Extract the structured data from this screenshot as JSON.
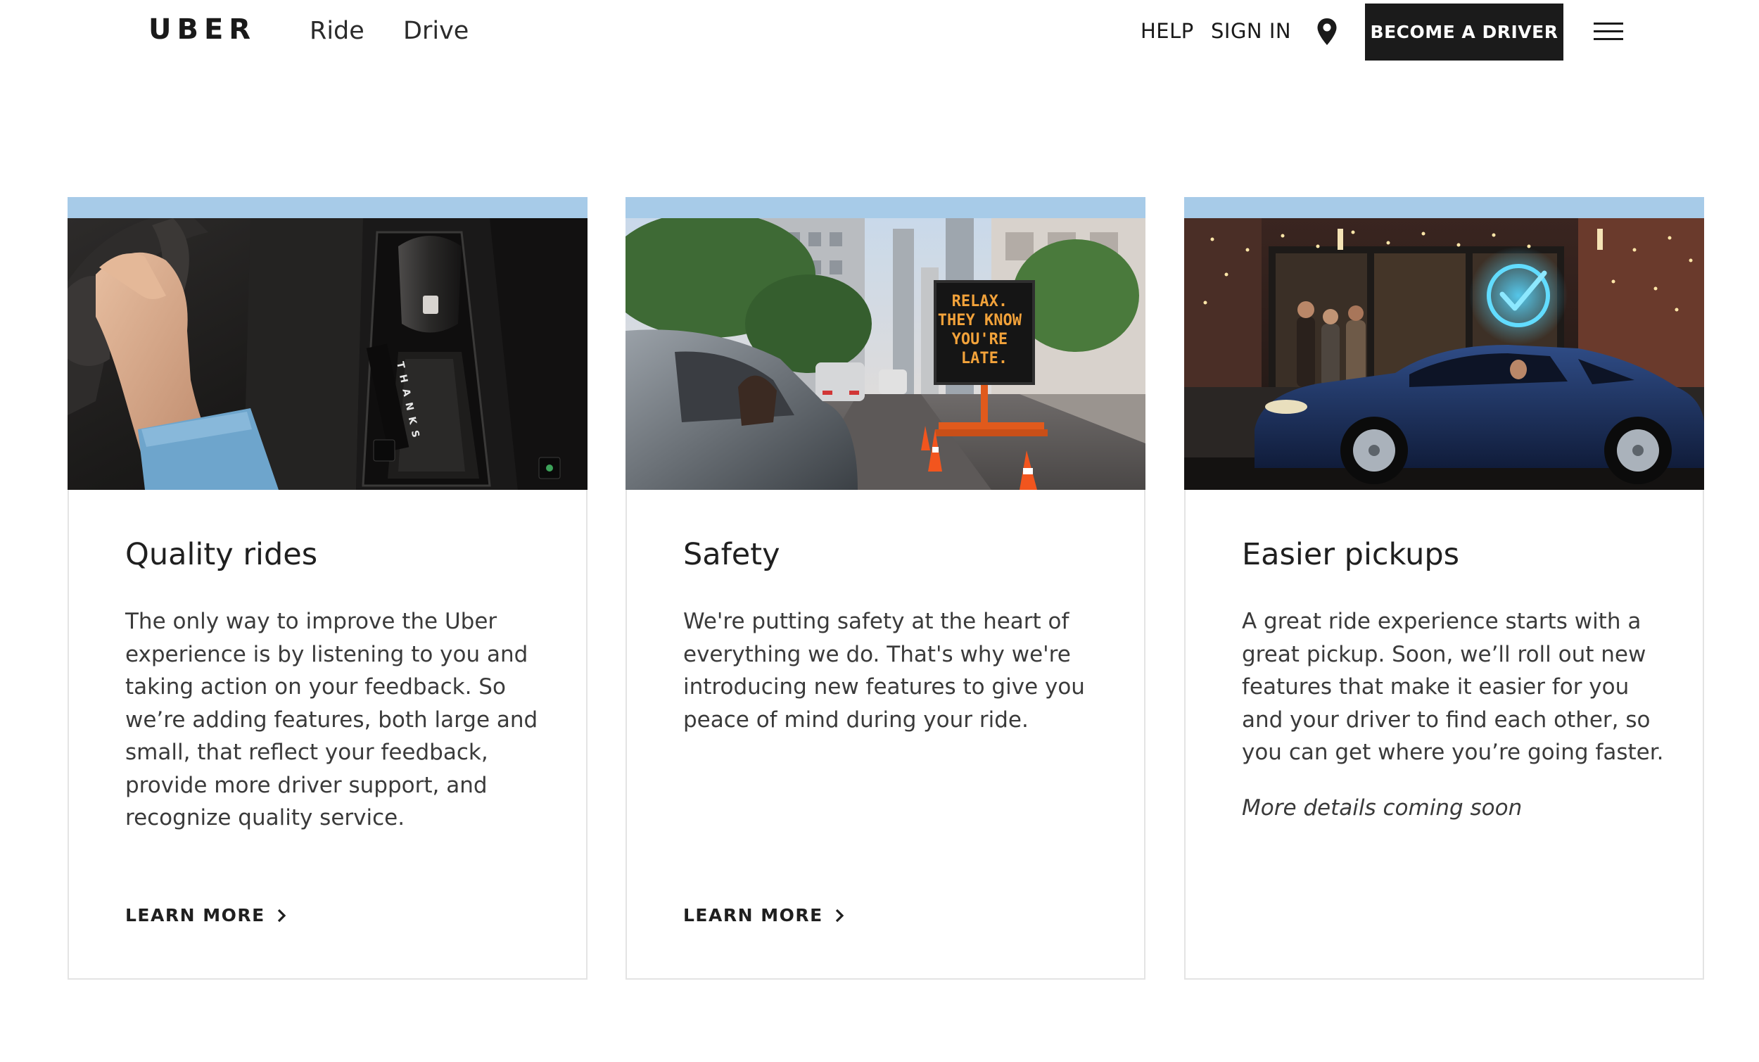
{
  "header": {
    "logo": "UBER",
    "nav": [
      "Ride",
      "Drive"
    ],
    "help_label": "HELP",
    "signin_label": "SIGN IN",
    "become_driver_label": "BECOME A DRIVER",
    "location_icon": "map-pin-icon",
    "menu_icon": "hamburger-menu-icon"
  },
  "colors": {
    "accent_bar": "#a7cbe8",
    "button_bg": "#1b1b1b",
    "text": "#1f1f1f"
  },
  "cards": [
    {
      "title": "Quality rides",
      "body": "The only way to improve the Uber experience is by listening to you and taking action on your feedback. So we’re adding features, both large and small, that reflect your feedback, provide more driver support, and recognize quality service.",
      "link": "LEARN MORE",
      "image_text": "THANKS"
    },
    {
      "title": "Safety",
      "body": "We're putting safety at the heart of everything we do. That's why we're introducing new features to give you peace of mind during your ride.",
      "link": "LEARN MORE",
      "sign_lines": [
        "RELAX.",
        "THEY KNOW",
        "YOU'RE",
        "LATE."
      ]
    },
    {
      "title": "Easier pickups",
      "body": "A great ride experience starts with a great pickup. Soon, we’ll roll out new features that make it easier for you and your driver to find each other, so you can get where you’re going faster.",
      "note": "More details coming soon"
    }
  ]
}
